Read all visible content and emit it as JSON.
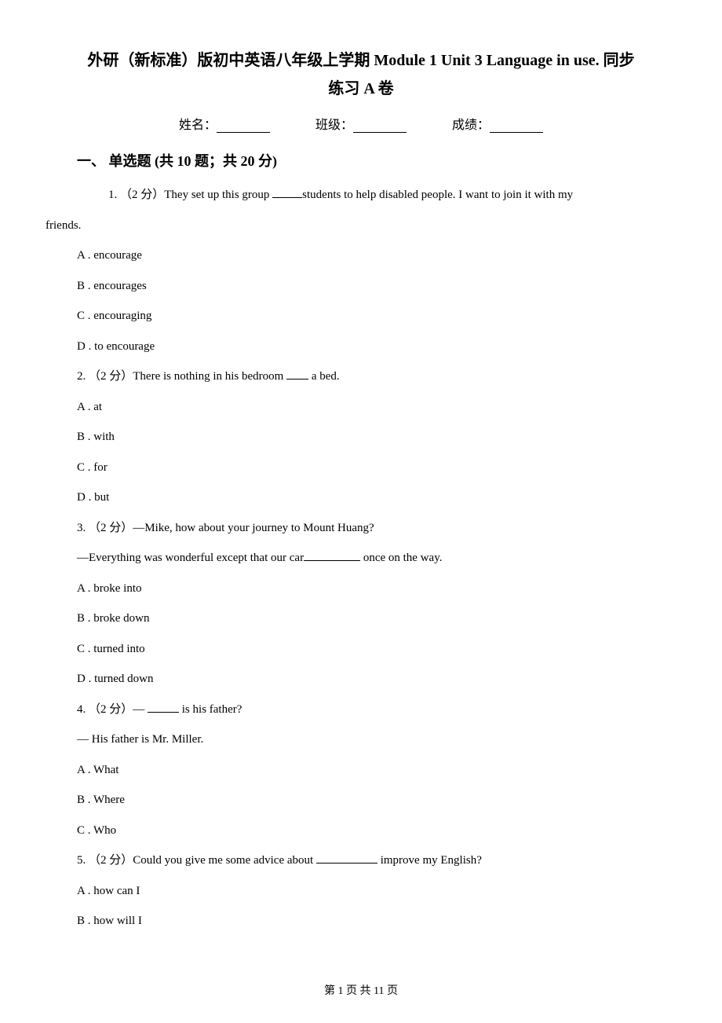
{
  "title_line1": "外研（新标准）版初中英语八年级上学期 Module 1 Unit 3 Language in use. 同步",
  "title_line2": "练习 A 卷",
  "info": {
    "name_label": "姓名：",
    "class_label": "班级：",
    "score_label": "成绩："
  },
  "section1_title": "一、 单选题 (共 10 题；共 20 分)",
  "q1": {
    "stem_prefix": "1. （2 分）They set up this group ",
    "stem_suffix": "students to help disabled people. I want to join it with my",
    "stem_line2": "friends.",
    "a": "A . encourage",
    "b": "B . encourages",
    "c": "C . encouraging",
    "d": "D . to encourage"
  },
  "q2": {
    "stem_prefix": "2. （2 分）There is nothing in his bedroom ",
    "stem_suffix": " a bed.",
    "a": "A . at",
    "b": "B . with",
    "c": "C . for",
    "d": "D . but"
  },
  "q3": {
    "stem": "3. （2 分）—Mike, how about your journey to Mount Huang?",
    "sub_prefix": "—Everything was wonderful except that our car",
    "sub_suffix": " once on the way.",
    "a": "A . broke into",
    "b": "B . broke down",
    "c": "C . turned into",
    "d": "D . turned down"
  },
  "q4": {
    "stem_prefix": "4. （2 分）— ",
    "stem_suffix": " is his father?",
    "sub": "— His father is Mr. Miller.",
    "a": "A . What",
    "b": "B . Where",
    "c": "C . Who"
  },
  "q5": {
    "stem_prefix": "5. （2 分）Could you give me some advice about ",
    "stem_suffix": " improve my English?",
    "a": "A . how can I",
    "b": "B . how will I"
  },
  "footer": "第 1 页 共 11 页"
}
